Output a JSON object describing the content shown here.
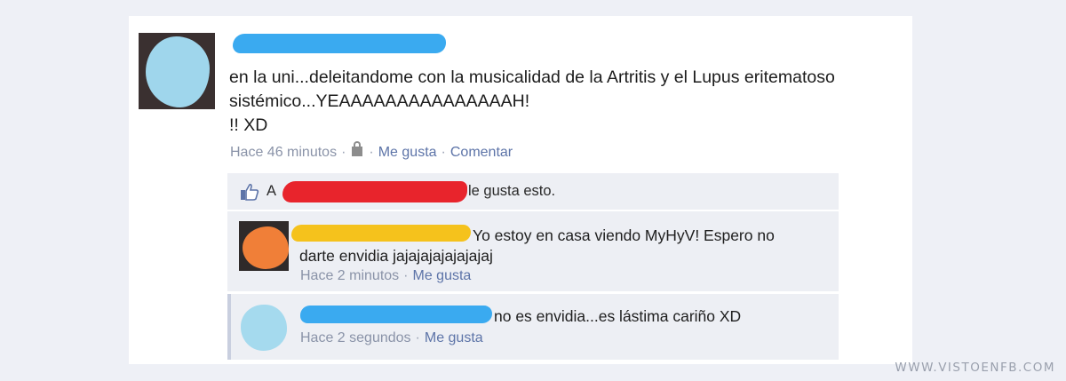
{
  "post": {
    "text": "en la uni...deleitandome con la musicalidad de la Artritis y el Lupus eritematoso\nsistémico...YEAAAAAAAAAAAAAAAH!\n!! XD",
    "time": "Hace 46 minutos",
    "like_label": "Me gusta",
    "comment_label": "Comentar"
  },
  "likes": {
    "prefix": "A",
    "suffix": "le gusta esto."
  },
  "comments": [
    {
      "text": "Yo estoy en casa viendo MyHyV! Espero no\ndarte envidia jajajajajajajajaj",
      "time": "Hace 2 minutos",
      "like_label": "Me gusta"
    },
    {
      "text": "no es envidia...es lástima cariño XD",
      "time": "Hace 2 segundos",
      "like_label": "Me gusta"
    }
  ],
  "watermark": "WWW.VISTOENFB.COM",
  "colors": {
    "redact_blue": "#3aaaf0",
    "redact_red": "#e8242c",
    "redact_yellow": "#f5c21c",
    "link": "#5d74a8",
    "meta_gray": "#8a93a8"
  }
}
